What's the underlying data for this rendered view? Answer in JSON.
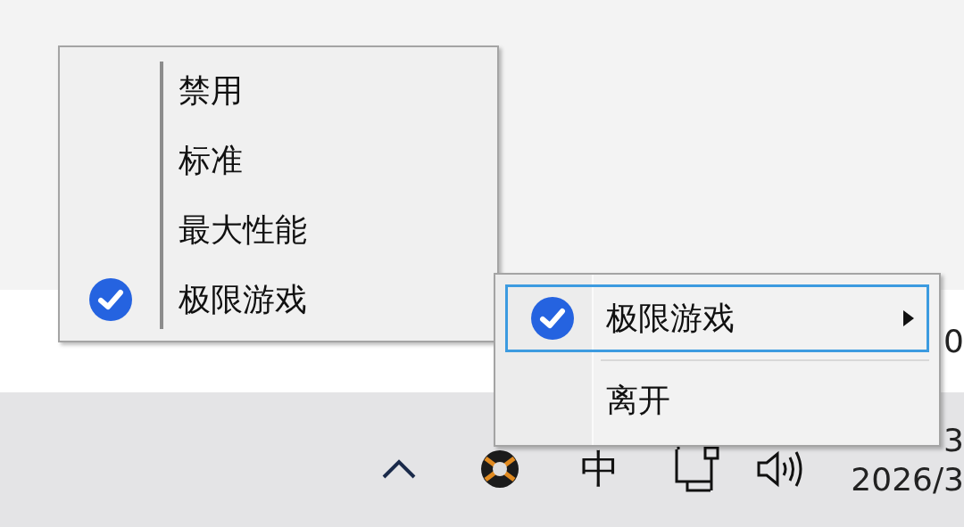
{
  "background_text": "0",
  "mode_menu": {
    "items": [
      {
        "label": "禁用",
        "checked": false
      },
      {
        "label": "标准",
        "checked": false
      },
      {
        "label": "最大性能",
        "checked": false
      },
      {
        "label": "极限游戏",
        "checked": true
      }
    ]
  },
  "tray_menu": {
    "items": [
      {
        "kind": "submenu",
        "label": "极限游戏",
        "checked": true,
        "highlighted": true
      },
      {
        "kind": "separator"
      },
      {
        "kind": "command",
        "label": "离开",
        "checked": false,
        "highlighted": false
      }
    ]
  },
  "taskbar": {
    "input_method": "中",
    "clock_time": "3",
    "clock_date": "2026/3"
  }
}
